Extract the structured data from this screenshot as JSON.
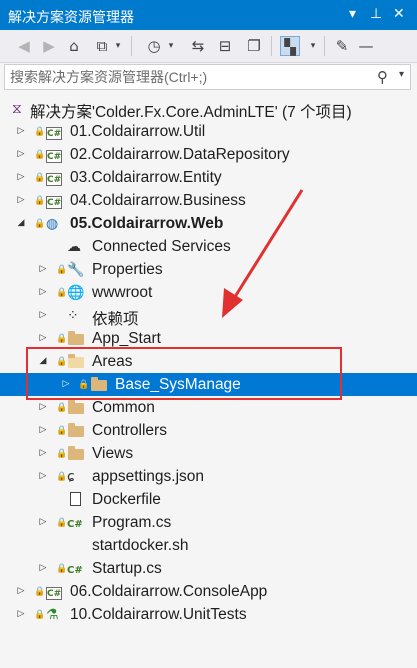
{
  "window": {
    "title": "解决方案资源管理器",
    "controls": {
      "dropdown": "▾",
      "pin": "⊥",
      "close": "✕"
    }
  },
  "toolbar": {
    "buttons": [
      "back",
      "forward",
      "home",
      "switch-views",
      "dropdown",
      "pending-changes",
      "dropdown",
      "sync",
      "collapse-all",
      "show-all-files",
      "preview",
      "dropdown",
      "properties",
      "minus"
    ]
  },
  "search": {
    "placeholder": "搜索解决方案资源管理器(Ctrl+;)",
    "value": ""
  },
  "tree": {
    "solution": "解决方案'Colder.Fx.Core.AdminLTE' (7 个项目)",
    "items": [
      {
        "label": "01.Coldairarrow.Util",
        "icon": "csproj-icon"
      },
      {
        "label": "02.Coldairarrow.DataRepository",
        "icon": "csproj-icon"
      },
      {
        "label": "03.Coldairarrow.Entity",
        "icon": "csproj-icon"
      },
      {
        "label": "04.Coldairarrow.Business",
        "icon": "csproj-icon"
      },
      {
        "label": "05.Coldairarrow.Web",
        "icon": "web-project-icon"
      },
      {
        "label": "Connected Services",
        "icon": "connected-services-icon"
      },
      {
        "label": "Properties",
        "icon": "wrench-icon"
      },
      {
        "label": "wwwroot",
        "icon": "globe-icon"
      },
      {
        "label": "依赖项",
        "icon": "dependencies-icon"
      },
      {
        "label": "App_Start",
        "icon": "folder-icon"
      },
      {
        "label": "Areas",
        "icon": "folder-open-icon"
      },
      {
        "label": "Base_SysManage",
        "icon": "folder-icon"
      },
      {
        "label": "Common",
        "icon": "folder-icon"
      },
      {
        "label": "Controllers",
        "icon": "folder-icon"
      },
      {
        "label": "Views",
        "icon": "folder-icon"
      },
      {
        "label": "appsettings.json",
        "icon": "json-icon"
      },
      {
        "label": "Dockerfile",
        "icon": "file-icon"
      },
      {
        "label": "Program.cs",
        "icon": "csharp-file-icon"
      },
      {
        "label": "startdocker.sh",
        "icon": "file-icon"
      },
      {
        "label": "Startup.cs",
        "icon": "csharp-file-icon"
      },
      {
        "label": "06.Coldairarrow.ConsoleApp",
        "icon": "csproj-icon"
      },
      {
        "label": "10.Coldairarrow.UnitTests",
        "icon": "test-project-icon"
      }
    ],
    "selected": "Base_SysManage"
  },
  "annotation": {
    "highlight_color": "#e03030"
  }
}
